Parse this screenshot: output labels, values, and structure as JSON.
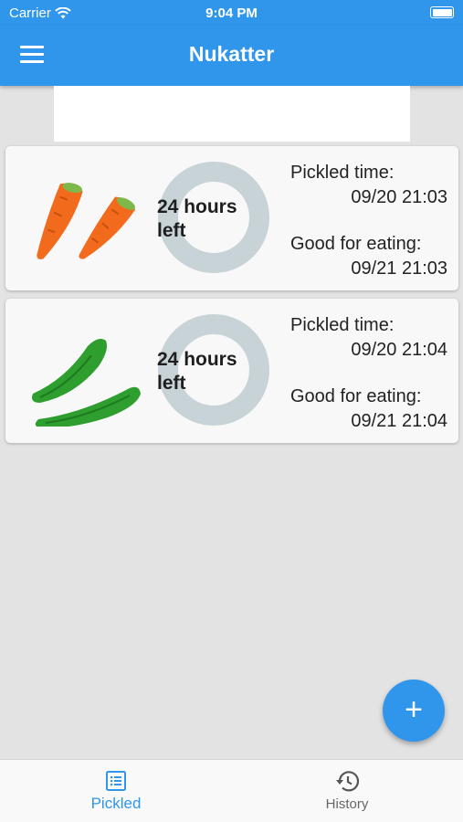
{
  "status_bar": {
    "carrier": "Carrier",
    "time": "9:04 PM"
  },
  "app_bar": {
    "title": "Nukatter",
    "menu_icon": "menu-icon"
  },
  "items": [
    {
      "vegetable": "carrot",
      "remaining": "24 hours left",
      "pickled_label": "Pickled time:",
      "pickled_value": "09/20 21:03",
      "eat_label": "Good for eating:",
      "eat_value": "09/21 21:03",
      "progress": 0.0
    },
    {
      "vegetable": "cucumber",
      "remaining": "24 hours left",
      "pickled_label": "Pickled time:",
      "pickled_value": "09/20 21:04",
      "eat_label": "Good for eating:",
      "eat_value": "09/21 21:04",
      "progress": 0.0
    }
  ],
  "fab": {
    "label": "+",
    "icon": "plus-icon"
  },
  "bottom_nav": [
    {
      "label": "Pickled",
      "icon": "list-icon",
      "active": true
    },
    {
      "label": "History",
      "icon": "history-icon",
      "active": false
    }
  ],
  "colors": {
    "primary": "#2f96ec",
    "ring_track": "#c8d3d8",
    "background": "#e3e3e3",
    "card": "#f8f8f8"
  }
}
